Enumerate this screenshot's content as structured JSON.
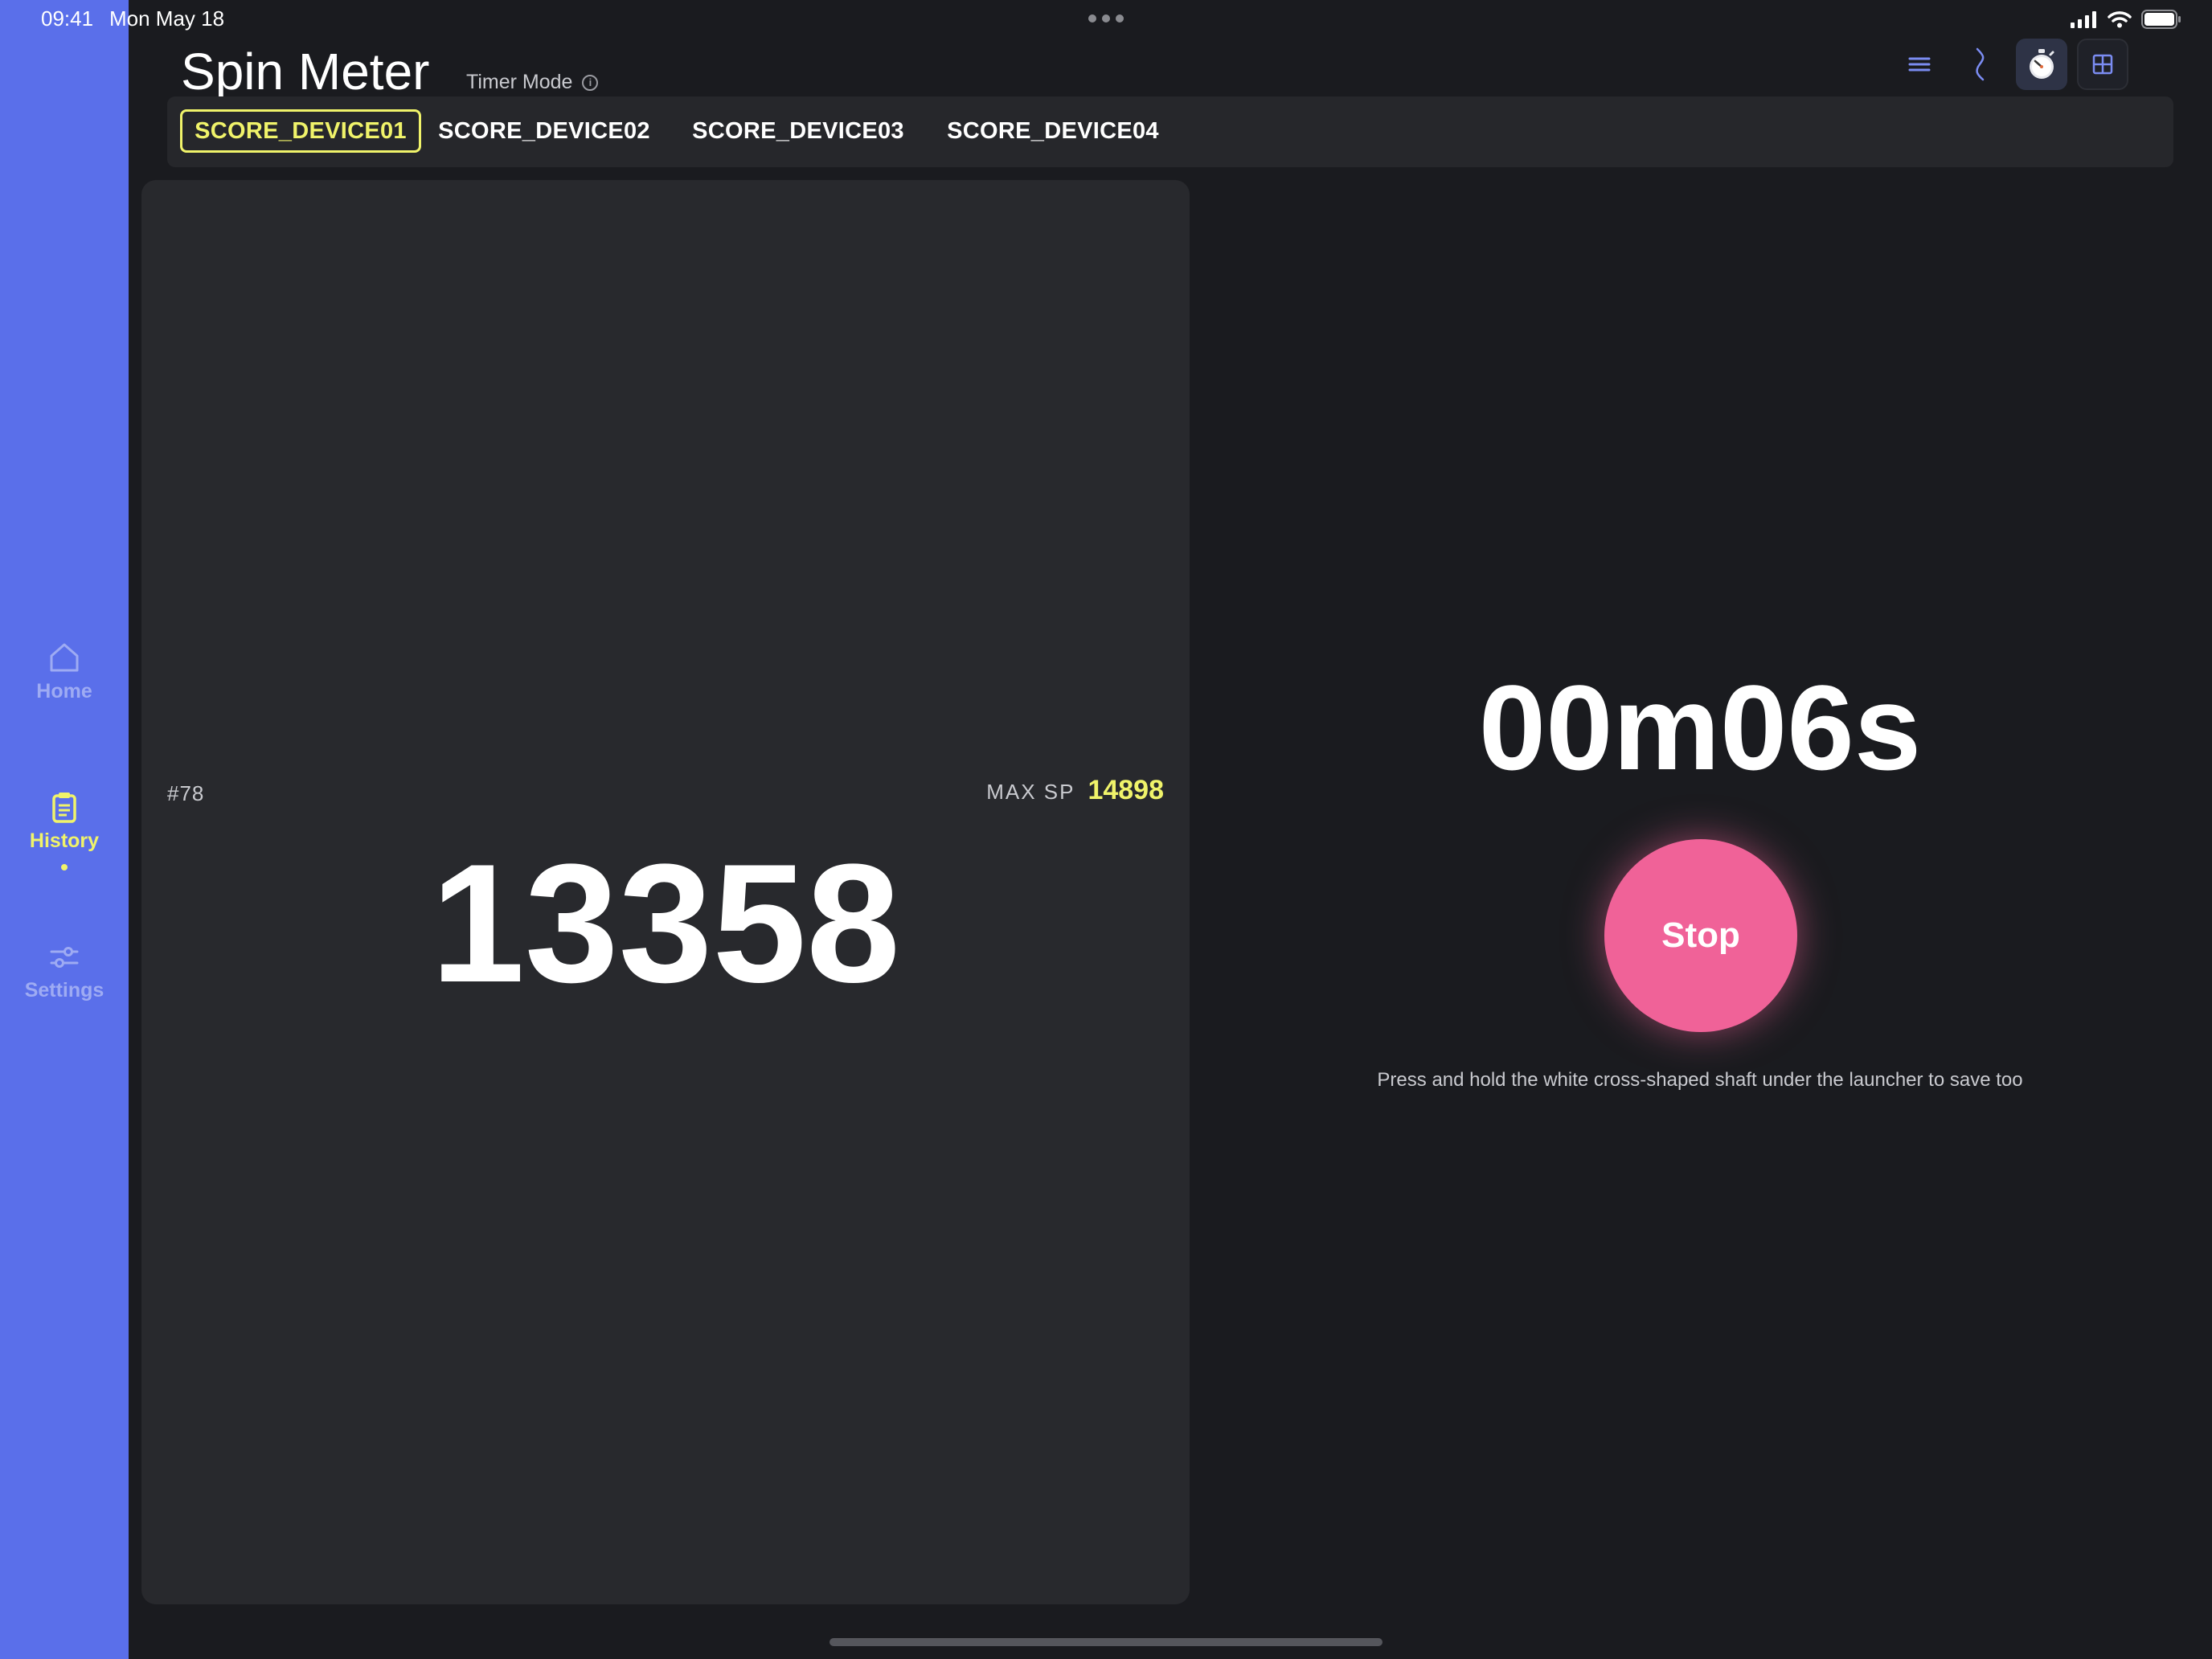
{
  "status_bar": {
    "time": "09:41",
    "date": "Mon May 18",
    "icons": [
      "cellular-signal-icon",
      "wifi-icon",
      "battery-icon"
    ]
  },
  "sidebar": {
    "background_color": "#5a6fea",
    "items": [
      {
        "label": "Home",
        "icon": "home-icon",
        "active": false
      },
      {
        "label": "History",
        "icon": "clipboard-icon",
        "active": true
      },
      {
        "label": "Settings",
        "icon": "sliders-icon",
        "active": false
      }
    ]
  },
  "header": {
    "title": "Spin Meter",
    "mode": "Timer Mode",
    "toolbar_icons": [
      "list-icon",
      "wave-icon",
      "stopwatch-icon",
      "grid-icon"
    ]
  },
  "tabs": [
    {
      "label": "SCORE_DEVICE01",
      "active": true
    },
    {
      "label": "SCORE_DEVICE02",
      "active": false
    },
    {
      "label": "SCORE_DEVICE03",
      "active": false
    },
    {
      "label": "SCORE_DEVICE04",
      "active": false
    }
  ],
  "score_card": {
    "session_number": "#78",
    "max_sp_label": "MAX SP",
    "max_sp_value": "14898",
    "current_score": "13358"
  },
  "timer": {
    "elapsed": "00m06s",
    "stop_label": "Stop",
    "hint": "Press and hold the white cross-shaped shaft under the launcher to save too"
  },
  "colors": {
    "accent_yellow": "#f0f36a",
    "stop_pink": "#f06298",
    "background": "#1a1b1f",
    "card": "#28292d"
  }
}
